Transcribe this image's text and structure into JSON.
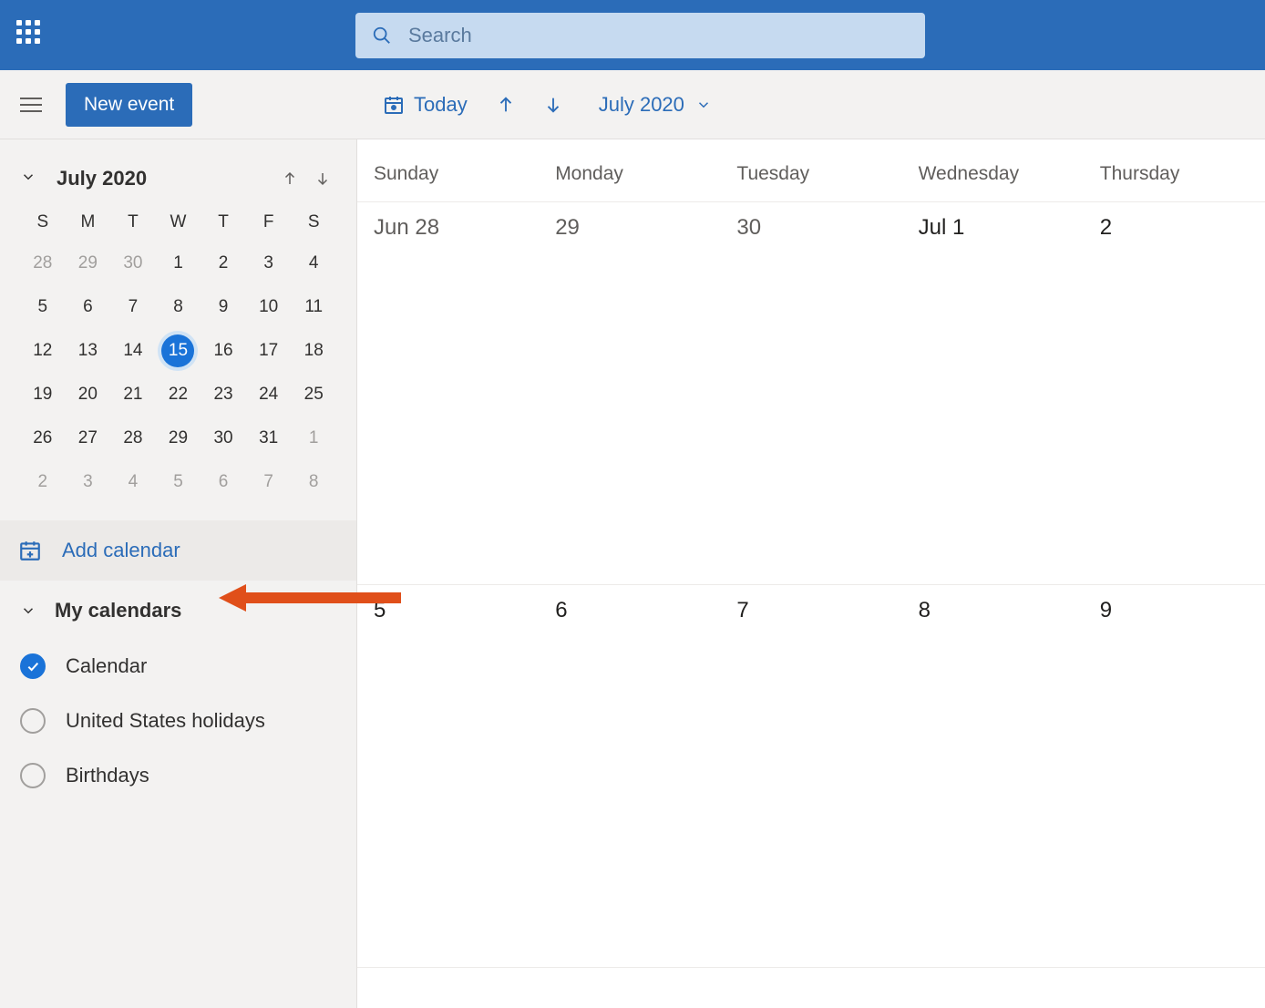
{
  "header": {
    "search_placeholder": "Search"
  },
  "toolbar": {
    "new_event_label": "New event",
    "today_label": "Today",
    "month_label": "July 2020"
  },
  "mini_calendar": {
    "title": "July 2020",
    "dow": [
      "S",
      "M",
      "T",
      "W",
      "T",
      "F",
      "S"
    ],
    "days": [
      {
        "n": "28",
        "muted": true
      },
      {
        "n": "29",
        "muted": true
      },
      {
        "n": "30",
        "muted": true
      },
      {
        "n": "1"
      },
      {
        "n": "2"
      },
      {
        "n": "3"
      },
      {
        "n": "4"
      },
      {
        "n": "5"
      },
      {
        "n": "6"
      },
      {
        "n": "7"
      },
      {
        "n": "8"
      },
      {
        "n": "9"
      },
      {
        "n": "10"
      },
      {
        "n": "11"
      },
      {
        "n": "12"
      },
      {
        "n": "13"
      },
      {
        "n": "14"
      },
      {
        "n": "15",
        "today": true
      },
      {
        "n": "16"
      },
      {
        "n": "17"
      },
      {
        "n": "18"
      },
      {
        "n": "19"
      },
      {
        "n": "20"
      },
      {
        "n": "21"
      },
      {
        "n": "22"
      },
      {
        "n": "23"
      },
      {
        "n": "24"
      },
      {
        "n": "25"
      },
      {
        "n": "26"
      },
      {
        "n": "27"
      },
      {
        "n": "28"
      },
      {
        "n": "29"
      },
      {
        "n": "30"
      },
      {
        "n": "31"
      },
      {
        "n": "1",
        "muted": true
      },
      {
        "n": "2",
        "muted": true
      },
      {
        "n": "3",
        "muted": true
      },
      {
        "n": "4",
        "muted": true
      },
      {
        "n": "5",
        "muted": true
      },
      {
        "n": "6",
        "muted": true
      },
      {
        "n": "7",
        "muted": true
      },
      {
        "n": "8",
        "muted": true
      }
    ]
  },
  "add_calendar_label": "Add calendar",
  "my_calendars": {
    "title": "My calendars",
    "items": [
      {
        "label": "Calendar",
        "checked": true
      },
      {
        "label": "United States holidays",
        "checked": false
      },
      {
        "label": "Birthdays",
        "checked": false
      }
    ]
  },
  "grid": {
    "dow": [
      "Sunday",
      "Monday",
      "Tuesday",
      "Wednesday",
      "Thursday"
    ],
    "rows": [
      [
        {
          "label": "Jun 28"
        },
        {
          "label": "29"
        },
        {
          "label": "30"
        },
        {
          "label": "Jul 1",
          "bold": true
        },
        {
          "label": "2",
          "bold": true
        }
      ],
      [
        {
          "label": "5",
          "bold": true
        },
        {
          "label": "6",
          "bold": true
        },
        {
          "label": "7",
          "bold": true
        },
        {
          "label": "8",
          "bold": true
        },
        {
          "label": "9",
          "bold": true
        }
      ]
    ]
  },
  "colors": {
    "accent": "#2b6cb8",
    "today": "#1a73d8",
    "annotation": "#e04f1a"
  }
}
